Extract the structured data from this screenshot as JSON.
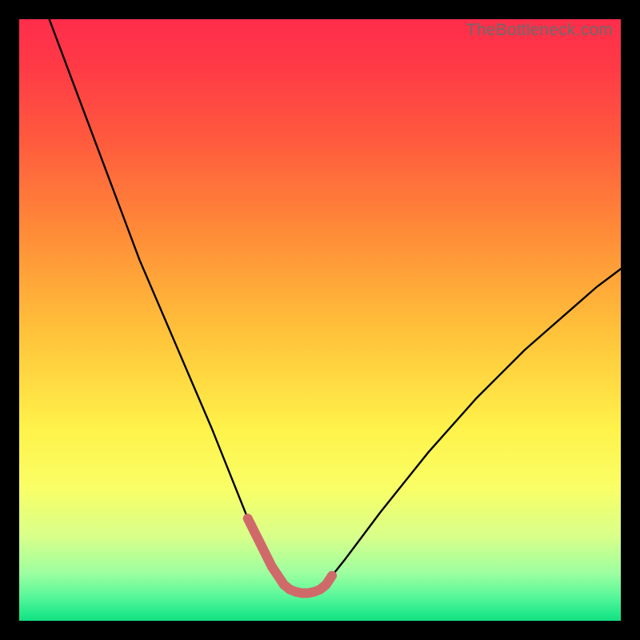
{
  "watermark": "TheBottleneck.com",
  "colors": {
    "frame": "#000000",
    "curve_stroke": "#000000",
    "highlight_stroke": "#d06a6a",
    "gradient_top": "#ff2d4b",
    "gradient_bottom": "#14df7f"
  },
  "chart_data": {
    "type": "line",
    "title": "",
    "xlabel": "",
    "ylabel": "",
    "xlim": [
      0,
      100
    ],
    "ylim": [
      0,
      100
    ],
    "x": [
      5,
      8,
      11,
      14,
      17,
      20,
      23,
      26,
      29,
      32,
      34,
      36,
      38,
      40,
      41,
      42,
      43,
      44,
      45,
      46,
      47,
      48,
      49,
      50,
      51,
      52,
      54,
      57,
      60,
      64,
      68,
      72,
      76,
      80,
      84,
      88,
      92,
      96,
      100
    ],
    "values": [
      100,
      92,
      84,
      76,
      68,
      60,
      53,
      46,
      39,
      32,
      27,
      22,
      17,
      13,
      11,
      9,
      7.5,
      6,
      5.2,
      4.8,
      4.6,
      4.6,
      4.8,
      5.2,
      6,
      7.5,
      10,
      14,
      18,
      23,
      28,
      32.5,
      37,
      41,
      45,
      48.5,
      52,
      55.5,
      58.5
    ],
    "highlight_range": {
      "x_start": 38,
      "x_end": 52,
      "description": "Flat bottom of V-curve highlighted in pink stroke",
      "approx_y": 4.6
    },
    "grid": false,
    "legend": false,
    "background": "vertical gradient red→yellow→green on black frame"
  }
}
